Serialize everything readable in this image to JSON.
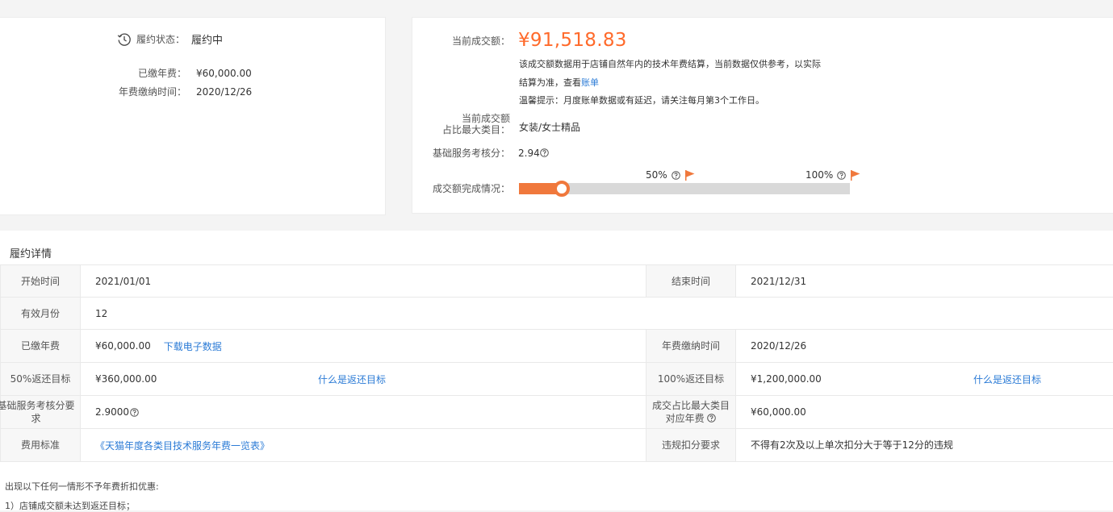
{
  "status": {
    "label": "履约状态：",
    "value": "履约中",
    "paid_fee_label": "已缴年费：",
    "paid_fee_value": "¥60,000.00",
    "payment_time_label": "年费缴纳时间：",
    "payment_time_value": "2020/12/26"
  },
  "summary": {
    "current_amount_label": "当前成交额：",
    "current_amount_value": "¥91,518.83",
    "note_line1": "该成交额数据用于店铺自然年内的技术年费结算，当前数据仅供参考，以实际",
    "note_line2": "结算为准，查看",
    "bill_link": "账单",
    "tip": "温馨提示：月度账单数据或有延迟，请关注每月第3个工作日。",
    "max_category_label_1": "当前成交额",
    "max_category_label_2": "占比最大类目：",
    "max_category_value": "女装/女士精品",
    "service_score_label": "基础服务考核分：",
    "service_score_value": "2.94",
    "progress_label": "成交额完成情况：",
    "milestone_50": "50%",
    "milestone_100": "100%",
    "progress_fraction": 0.13
  },
  "detail": {
    "title": "履约详情",
    "start_label": "开始时间",
    "start_value": "2021/01/01",
    "end_label": "结束时间",
    "end_value": "2021/12/31",
    "months_label": "有效月份",
    "months_value": "12",
    "paid_label": "已缴年费",
    "paid_value": "¥60,000.00",
    "download_link": "下载电子数据",
    "paid_time_label": "年费缴纳时间",
    "paid_time_value": "2020/12/26",
    "target50_label": "50%返还目标",
    "target50_value": "¥360,000.00",
    "target_help_link": "什么是返还目标",
    "target100_label": "100%返还目标",
    "target100_value": "¥1,200,000.00",
    "score_req_label": "基础服务考核分要求",
    "score_req_value": "2.9000",
    "category_fee_label_1": "成交占比最大类目",
    "category_fee_label_2": "对应年费",
    "category_fee_value": "¥60,000.00",
    "fee_standard_label": "费用标准",
    "fee_standard_link": "《天猫年度各类目技术服务年费一览表》",
    "violation_label": "违规扣分要求",
    "violation_value": "不得有2次及以上单次扣分大于等于12分的违规"
  },
  "notes": {
    "heading": "出现以下任何一情形不予年费折扣优惠:",
    "item1": "1）店铺成交额未达到返还目标；"
  },
  "colors": {
    "accent": "#ff6a2b",
    "link": "#2b7bd6",
    "progress": "#f0783c"
  }
}
